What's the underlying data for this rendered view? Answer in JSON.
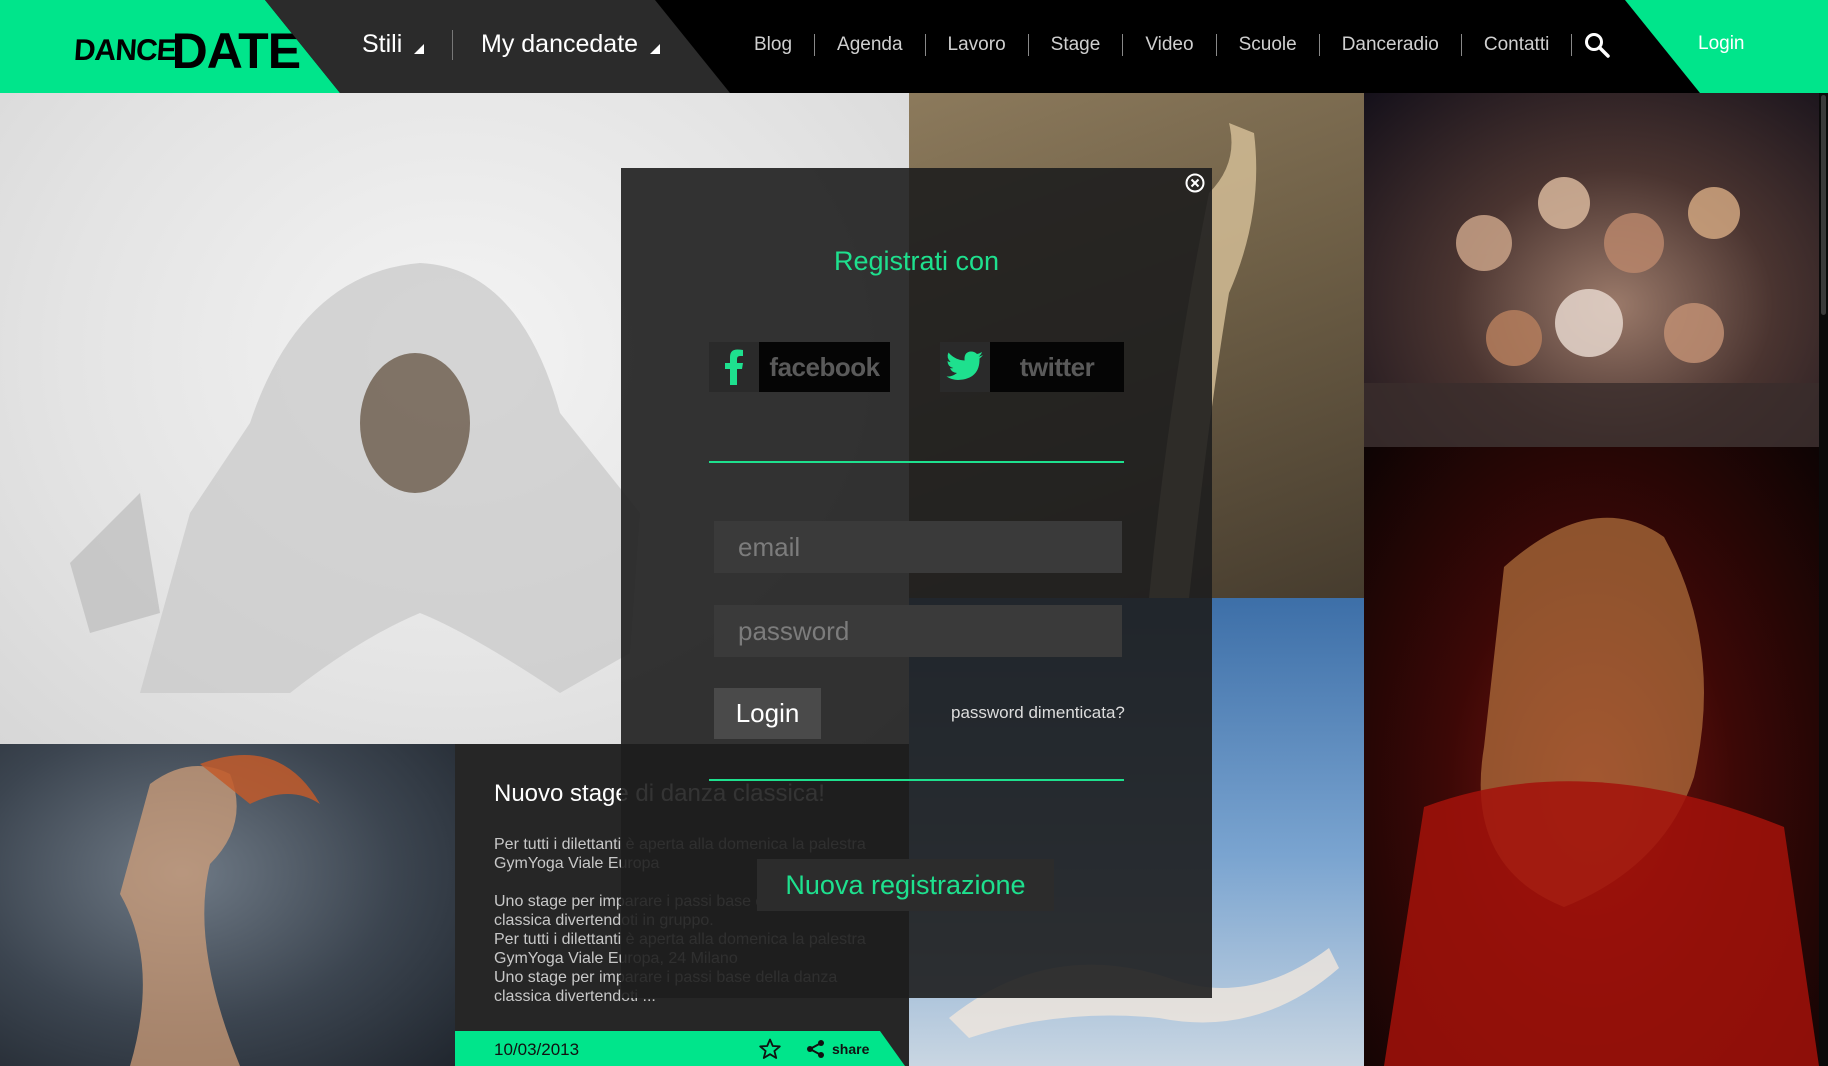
{
  "header": {
    "logo_dance": "DANCE",
    "logo_date": "DATE",
    "menu_styles": "Stili",
    "menu_my": "My dancedate",
    "nav": [
      "Blog",
      "Agenda",
      "Lavoro",
      "Stage",
      "Video",
      "Scuole",
      "Danceradio",
      "Contatti"
    ],
    "login": "Login"
  },
  "article": {
    "title": "Nuovo stage di danza classica!",
    "body": [
      "Per tutti i dilettanti è aperta alla domenica la palestra GymYoga Viale Europa",
      "Uno stage per imparare i passi base della danza classica divertendoti in gruppo.",
      "Per tutti i dilettanti è aperta alla domenica la palestra GymYoga Viale Europa, 24 Milano",
      "Uno stage per imparare i passi base della danza classica divertendoti ..."
    ],
    "date": "10/03/2013",
    "share": "share"
  },
  "modal": {
    "title": "Registrati con",
    "facebook": "facebook",
    "twitter": "twitter",
    "email_placeholder": "email",
    "password_placeholder": "password",
    "login_button": "Login",
    "forgot": "password dimenticata?",
    "register": "Nuova registrazione"
  },
  "colors": {
    "accent": "#00e58b",
    "modal_text": "#1ee08e",
    "header_bg": "#000000"
  }
}
